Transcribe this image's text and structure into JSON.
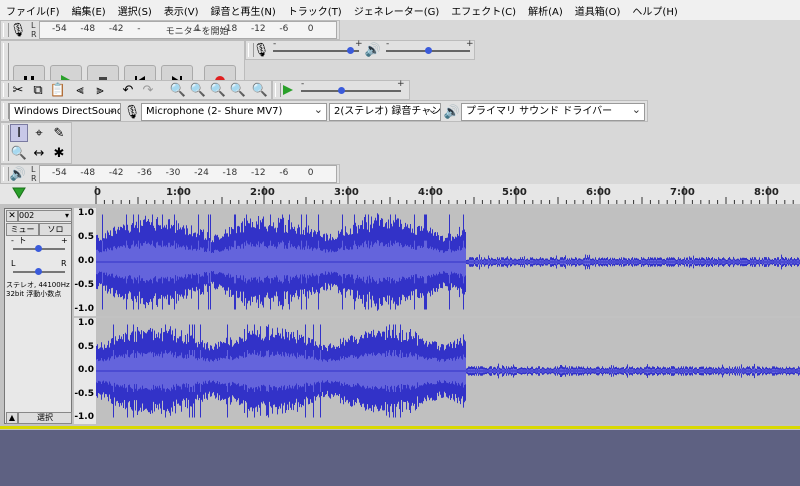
{
  "menu": [
    "ファイル(F)",
    "編集(E)",
    "選択(S)",
    "表示(V)",
    "録音と再生(N)",
    "トラック(T)",
    "ジェネレーター(G)",
    "エフェクト(C)",
    "解析(A)",
    "道具箱(O)",
    "ヘルプ(H)"
  ],
  "rec_meter": {
    "ticks": [
      "-54",
      "-48",
      "-42",
      "-",
      "モニターを開始",
      "4",
      "-18",
      "-12",
      "-6",
      "0"
    ],
    "l": "L",
    "r": "R"
  },
  "play_meter": {
    "ticks": [
      "-54",
      "-48",
      "-42",
      "-36",
      "-30",
      "-24",
      "-18",
      "-12",
      "-6",
      "0"
    ],
    "l": "L",
    "r": "R"
  },
  "transport": [
    "pause",
    "play",
    "stop",
    "skip-start",
    "skip-end",
    "record"
  ],
  "mixer": {
    "rec_volume": 0.9,
    "play_volume": 0.5
  },
  "play_at_speed": 0.4,
  "slider_marks": {
    "minus": "-",
    "plus": "+"
  },
  "device": {
    "host": "Windows DirectSound",
    "input": "Microphone (2- Shure MV7)",
    "channels": "2(ステレオ) 録音チャンネル",
    "output": "プライマリ サウンド ドライバー"
  },
  "timeline": {
    "labels": [
      "0",
      "1:00",
      "2:00",
      "3:00",
      "4:00",
      "5:00",
      "6:00",
      "7:00",
      "8:00"
    ],
    "max_minutes": 8.55
  },
  "track": {
    "name": "002",
    "mute": "ミュート",
    "solo": "ソロ",
    "gain_minus": "-",
    "gain_plus": "+",
    "pan_left": "L",
    "pan_right": "R",
    "info1": "ステレオ, 44100Hz",
    "info2": "32bit 浮動小数点",
    "select": "選択",
    "scale": [
      "1.0",
      "0.5",
      "0.0",
      "-0.5",
      "-1.0"
    ],
    "loud_end_minutes": 4.4
  },
  "colors": {
    "wave": "#3232c8",
    "wave_rms": "#6464dc",
    "selection": "#d8d800",
    "background": "#5e6182"
  }
}
